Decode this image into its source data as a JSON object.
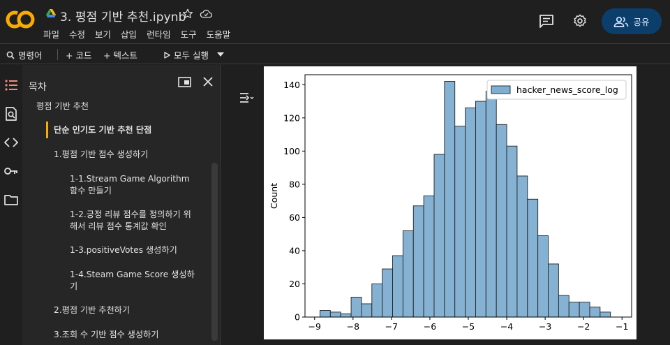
{
  "app": {
    "logo_text": "CO",
    "title": "3. 평점 기반 추천.ipynb",
    "menu": [
      "파일",
      "수정",
      "보기",
      "삽입",
      "런타임",
      "도구",
      "도움말"
    ],
    "share_label": "공유"
  },
  "toolbar": {
    "command_label": "명령어",
    "code_label": "+ 코드",
    "text_label": "+ 텍스트",
    "run_all_label": "모두 실행"
  },
  "toc": {
    "title": "목차",
    "items": [
      {
        "label": "평점 기반 추천"
      },
      {
        "label": "단순 인기도 기반 추천 단점"
      },
      {
        "label": "1.평점 기반 점수 생성하기"
      },
      {
        "label": "1-1.Stream Game Algorithm 함수 만들기"
      },
      {
        "label": "1-2.긍정 리뷰 점수를 정의하기 위해서 리뷰 점수 통계값 확인"
      },
      {
        "label": "1-3.positiveVotes 생성하기"
      },
      {
        "label": "1-4.Steam Game Score 생성하기"
      },
      {
        "label": "2.평점 기반 추천하기"
      },
      {
        "label": "3.조회 수 기반 점수 생성하기"
      }
    ]
  },
  "colors": {
    "accent_orange": "#f9ab00",
    "share_bg": "#0b3e6b",
    "bar_fill": "#7eaed0",
    "bar_edge": "#222222"
  },
  "chart_data": {
    "type": "bar",
    "ylabel": "Count",
    "xlabel": "",
    "legend": [
      "hacker_news_score_log"
    ],
    "legend_placement": "top-right",
    "xlim": [
      -9.25,
      -0.75
    ],
    "ylim": [
      0,
      146
    ],
    "x_ticks": [
      -9,
      -8,
      -7,
      -6,
      -5,
      -4,
      -3,
      -2,
      -1
    ],
    "y_ticks": [
      0,
      20,
      40,
      60,
      80,
      100,
      120,
      140
    ],
    "bin_width": 0.27,
    "bin_starts": [
      -8.86,
      -8.59,
      -8.32,
      -8.05,
      -7.78,
      -7.51,
      -7.24,
      -6.97,
      -6.7,
      -6.43,
      -6.16,
      -5.89,
      -5.62,
      -5.35,
      -5.08,
      -4.81,
      -4.54,
      -4.27,
      -4.0,
      -3.73,
      -3.46,
      -3.19,
      -2.92,
      -2.65,
      -2.38,
      -2.11,
      -1.84,
      -1.57,
      -1.3
    ],
    "values": [
      4,
      3,
      2,
      12,
      8,
      20,
      29,
      37,
      52,
      67,
      73,
      98,
      142,
      115,
      126,
      130,
      136,
      116,
      103,
      85,
      71,
      49,
      32,
      13,
      9,
      9,
      6,
      3,
      0,
      1
    ],
    "grid": false
  }
}
